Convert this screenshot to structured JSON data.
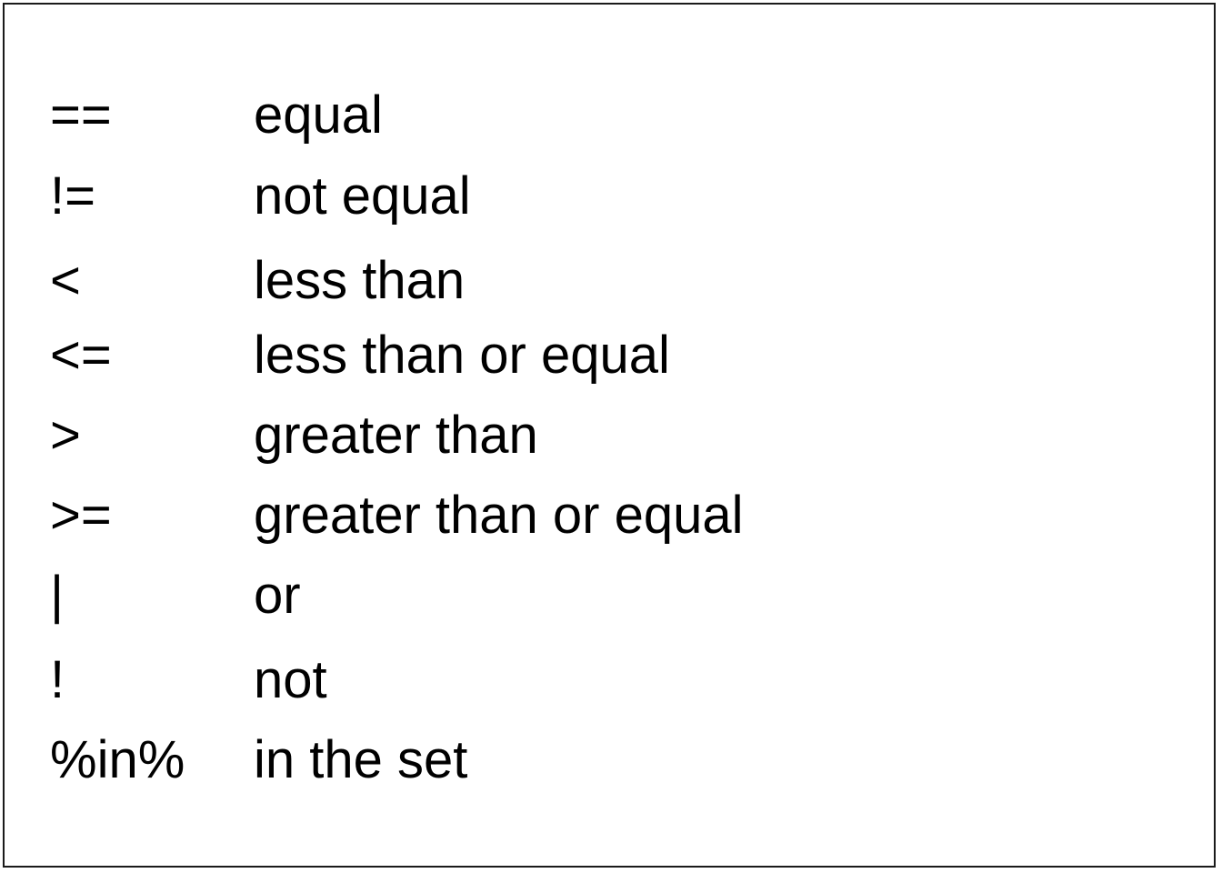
{
  "operators": [
    {
      "symbol": "==",
      "meaning": "equal"
    },
    {
      "symbol": "!=",
      "meaning": "not equal"
    },
    {
      "symbol": "<",
      "meaning": "less than"
    },
    {
      "symbol": "<=",
      "meaning": "less than or equal"
    },
    {
      "symbol": ">",
      "meaning": "greater than"
    },
    {
      "symbol": ">=",
      "meaning": "greater than or equal"
    },
    {
      "symbol": "|",
      "meaning": "or"
    },
    {
      "symbol": "!",
      "meaning": "not"
    },
    {
      "symbol": "%in%",
      "meaning": "in the set"
    }
  ]
}
